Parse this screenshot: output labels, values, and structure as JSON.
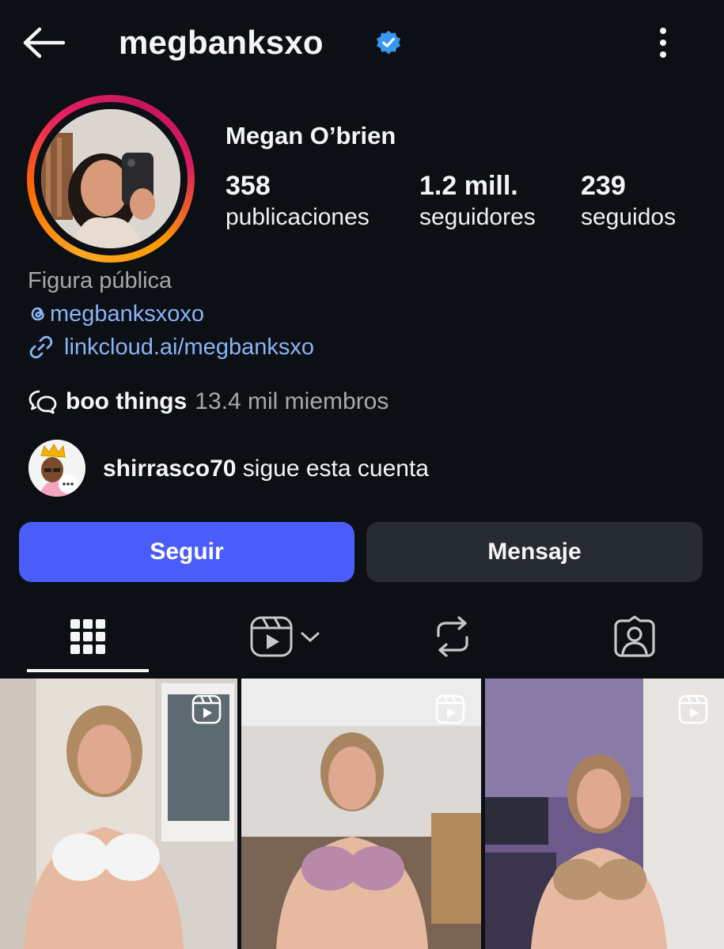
{
  "header": {
    "back_icon": "arrow-left-icon",
    "username": "megbanksxo",
    "verified_icon": "verified-badge-icon",
    "verified_color": "#3897f0",
    "more_icon": "more-vertical-icon"
  },
  "profile": {
    "full_name": "Megan O’brien",
    "stats": [
      {
        "value": "358",
        "label": "publicaciones"
      },
      {
        "value": "1.2 mill.",
        "label": "seguidores"
      },
      {
        "value": "239",
        "label": "seguidos"
      }
    ],
    "category": "Figura pública",
    "threads_handle": "megbanksxoxo",
    "threads_icon": "threads-icon",
    "link": "linkcloud.ai/megbanksxo",
    "link_icon": "link-icon",
    "channel": {
      "icon": "broadcast-channel-icon",
      "name": "boo things",
      "members": "13.4 mil miembros"
    },
    "followed_by": {
      "user": "shirrasco70",
      "text": "sigue esta cuenta"
    }
  },
  "actions": {
    "follow_label": "Seguir",
    "message_label": "Mensaje",
    "follow_color": "#4a5df9"
  },
  "tabs": [
    {
      "name": "posts-grid",
      "icon": "grid-icon",
      "active": true
    },
    {
      "name": "reels",
      "icon": "reels-icon",
      "active": false
    },
    {
      "name": "reposts",
      "icon": "repost-icon",
      "active": false
    },
    {
      "name": "tagged",
      "icon": "tagged-user-icon",
      "active": false
    }
  ],
  "posts": [
    {
      "type": "reel",
      "icon": "reels-badge-icon"
    },
    {
      "type": "reel",
      "icon": "reels-badge-icon"
    },
    {
      "type": "reel",
      "icon": "reels-badge-icon"
    }
  ]
}
